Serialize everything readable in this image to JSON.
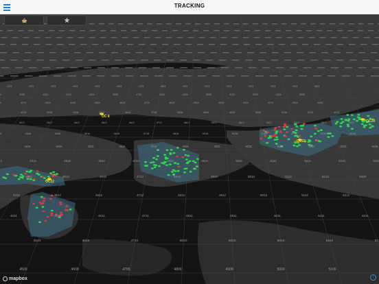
{
  "app": {
    "title": "TRACKING"
  },
  "toolbar": {
    "left_icon": "shopping-basket-icon",
    "right_icon": "star-badge-icon"
  },
  "map": {
    "attribution": "mapbox",
    "cluster_labels": [
      "OC 8",
      "OC22",
      "OC24",
      "OC23"
    ],
    "row_bottom": [
      "4509",
      "4609",
      "4709",
      "4809",
      "4909",
      "5009",
      "5109",
      "5209",
      "5309"
    ],
    "row_5": [
      "4510",
      "4610",
      "4710",
      "4810",
      "4910",
      "5010",
      "5110",
      "5210",
      "5310"
    ],
    "row_4": [
      "4411",
      "4511",
      "4611",
      "4711",
      "4811",
      "4911",
      "5011",
      "5111",
      "5211",
      "5311",
      "5411"
    ],
    "row_3": [
      "4412",
      "4512",
      "4612",
      "4712",
      "4812",
      "4912",
      "5012",
      "5112",
      "5212",
      "5312",
      "5412"
    ],
    "row_2": [
      "4313",
      "4413",
      "4513",
      "4613",
      "4713",
      "4813",
      "4913",
      "5013",
      "5113",
      "5213",
      "5313",
      "5413",
      "5513"
    ],
    "row_1": [
      "4314",
      "4414",
      "4514",
      "4614",
      "4714",
      "4814",
      "4914",
      "5014",
      "5114",
      "5214",
      "5314",
      "5414",
      "5514"
    ],
    "row_0": [
      "4215",
      "4315",
      "4415",
      "4515",
      "4615",
      "4715",
      "4815",
      "4915",
      "5015",
      "5115",
      "5215",
      "5315",
      "5415"
    ],
    "row_m1": [
      "4216",
      "4316",
      "4416",
      "4516",
      "4616",
      "4716",
      "4816",
      "4916",
      "5016",
      "5116",
      "5216",
      "5316",
      "5416"
    ],
    "row_m2": [
      "4117",
      "4217",
      "4317",
      "4417",
      "4517",
      "4617",
      "4717",
      "4817",
      "4917",
      "5017",
      "5117",
      "5217",
      "5317",
      "5417"
    ],
    "row_m3": [
      "4118",
      "4218",
      "4318",
      "4418",
      "4518",
      "4618",
      "4718",
      "4818",
      "4918",
      "5018",
      "5118",
      "5218",
      "5318",
      "5418"
    ],
    "row_m4": [
      "4119",
      "4219",
      "4319",
      "4419",
      "4519",
      "4619",
      "4719",
      "4819",
      "4919",
      "5019",
      "5119",
      "5219",
      "5319",
      "5419"
    ],
    "row_m5": [
      "4120",
      "4220",
      "4320",
      "4420",
      "4520",
      "4620",
      "4720",
      "4820",
      "4920",
      "5020",
      "5120",
      "5220",
      "5320",
      "5420"
    ],
    "row_m6": [
      "4021",
      "4121",
      "4221",
      "4321",
      "4421",
      "4521",
      "4621",
      "4721",
      "4821",
      "4921",
      "5021",
      "5121",
      "5221",
      "5321",
      "5421",
      "5521"
    ],
    "colors": {
      "green": "#2fd64a",
      "red": "#e0363e",
      "yellow": "#f3d31b",
      "zone": "#4a7f9a"
    }
  }
}
